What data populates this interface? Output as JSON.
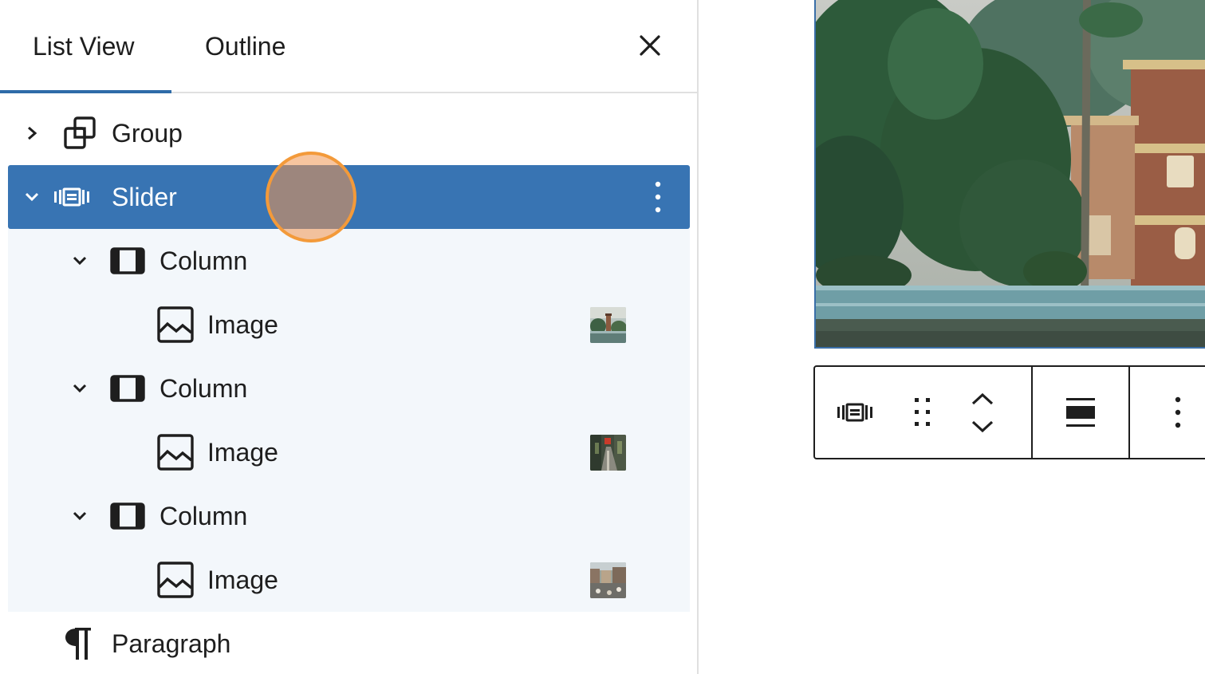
{
  "sidebar": {
    "tabs": [
      {
        "label": "List View",
        "active": true
      },
      {
        "label": "Outline",
        "active": false
      }
    ],
    "close_icon": "close-icon",
    "accent_color": "#3874b3",
    "items": [
      {
        "label": "Group",
        "icon": "group-icon",
        "expanded": false,
        "level": 1
      },
      {
        "label": "Slider",
        "icon": "slider-icon",
        "expanded": true,
        "level": 1,
        "selected": true
      },
      {
        "label": "Column",
        "icon": "column-icon",
        "expanded": true,
        "level": 2
      },
      {
        "label": "Image",
        "icon": "image-icon",
        "level": 3,
        "has_thumbnail": true
      },
      {
        "label": "Column",
        "icon": "column-icon",
        "expanded": true,
        "level": 2
      },
      {
        "label": "Image",
        "icon": "image-icon",
        "level": 3,
        "has_thumbnail": true
      },
      {
        "label": "Column",
        "icon": "column-icon",
        "expanded": true,
        "level": 2
      },
      {
        "label": "Image",
        "icon": "image-icon",
        "level": 3,
        "has_thumbnail": true
      },
      {
        "label": "Paragraph",
        "icon": "paragraph-icon",
        "level": 1
      }
    ]
  },
  "block_toolbar": {
    "buttons": [
      "slider-icon",
      "drag-handle-icon",
      "move-up-icon",
      "move-down-icon",
      "align-icon",
      "more-options-icon"
    ]
  }
}
